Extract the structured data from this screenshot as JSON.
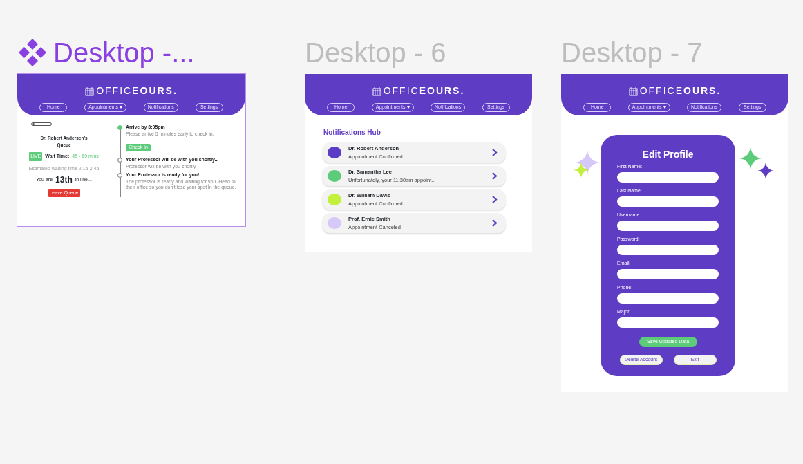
{
  "canvas": {
    "frames": [
      {
        "title": "Desktop -...",
        "selected": true,
        "kind": "queue",
        "header": {
          "logo": "OFFICE**OURS.**",
          "nav": [
            {
              "label": "Home",
              "has_menu": false
            },
            {
              "label": "Appointments",
              "has_menu": true
            },
            {
              "label": "Notifications",
              "has_menu": false
            },
            {
              "label": "Settings",
              "has_menu": false
            }
          ]
        },
        "queue": {
          "doctor": "Dr. Robert Andersen's Queue",
          "live": "LIVE",
          "wait_label": "Wait Time:",
          "wait_value": "45 - 60 mins",
          "estimate": "Estimated waiting time 2:15-2:45",
          "position_prefix": "You are",
          "position": "13th",
          "position_suffix": "in line...",
          "leave_button": "Leave Queue",
          "steps": [
            {
              "title": "Arrive by 3:05pm",
              "detail": "Please arrive 5 minutes early to check in.",
              "button": "Check In",
              "done": true
            },
            {
              "title": "Your Professor will be with you shortly...",
              "detail": "Professor will be with you shortly",
              "done": false
            },
            {
              "title": "Your Professor is ready for you!",
              "detail": "The professor is ready and waiting for you. Head to their office so you don't lose your spot in the queue.",
              "done": false
            }
          ]
        }
      },
      {
        "title": "Desktop - 6",
        "selected": false,
        "kind": "notifications",
        "header": {
          "logo": "OFFICE**OURS.**",
          "nav": [
            {
              "label": "Home",
              "has_menu": false
            },
            {
              "label": "Appointments",
              "has_menu": true
            },
            {
              "label": "Notifications",
              "has_menu": false
            },
            {
              "label": "Settings",
              "has_menu": false
            }
          ]
        },
        "notifications": {
          "heading": "Notifications Hub",
          "items": [
            {
              "name": "Dr. Robert Anderson",
              "message": "Appointment Confirmed",
              "color": "#5b3cc4"
            },
            {
              "name": "Dr. Samantha Lee",
              "message": "Unfortunately, your 11:30am appoint...",
              "color": "#5ccb7a"
            },
            {
              "name": "Dr. William Davis",
              "message": "Appointment Confirmed",
              "color": "#c2f03c"
            },
            {
              "name": "Prof. Ernie Smith",
              "message": "Appointment Canceled",
              "color": "#d6c8f8"
            }
          ]
        }
      },
      {
        "title": "Desktop - 7",
        "selected": false,
        "kind": "profile",
        "header": {
          "logo": "OFFICE**OURS.**",
          "nav": [
            {
              "label": "Home",
              "has_menu": false
            },
            {
              "label": "Appointments",
              "has_menu": true
            },
            {
              "label": "Notifications",
              "has_menu": false
            },
            {
              "label": "Settings",
              "has_menu": false
            }
          ]
        },
        "profile": {
          "heading": "Edit Profile",
          "fields": [
            {
              "label": "First Name:"
            },
            {
              "label": "Last Name:"
            },
            {
              "label": "Username:"
            },
            {
              "label": "Password:"
            },
            {
              "label": "Email:"
            },
            {
              "label": "Phone:"
            },
            {
              "label": "Major:"
            }
          ],
          "save_button": "Save Updated Data",
          "secondary_buttons": [
            "Delete Account",
            "Exit"
          ]
        }
      }
    ]
  }
}
